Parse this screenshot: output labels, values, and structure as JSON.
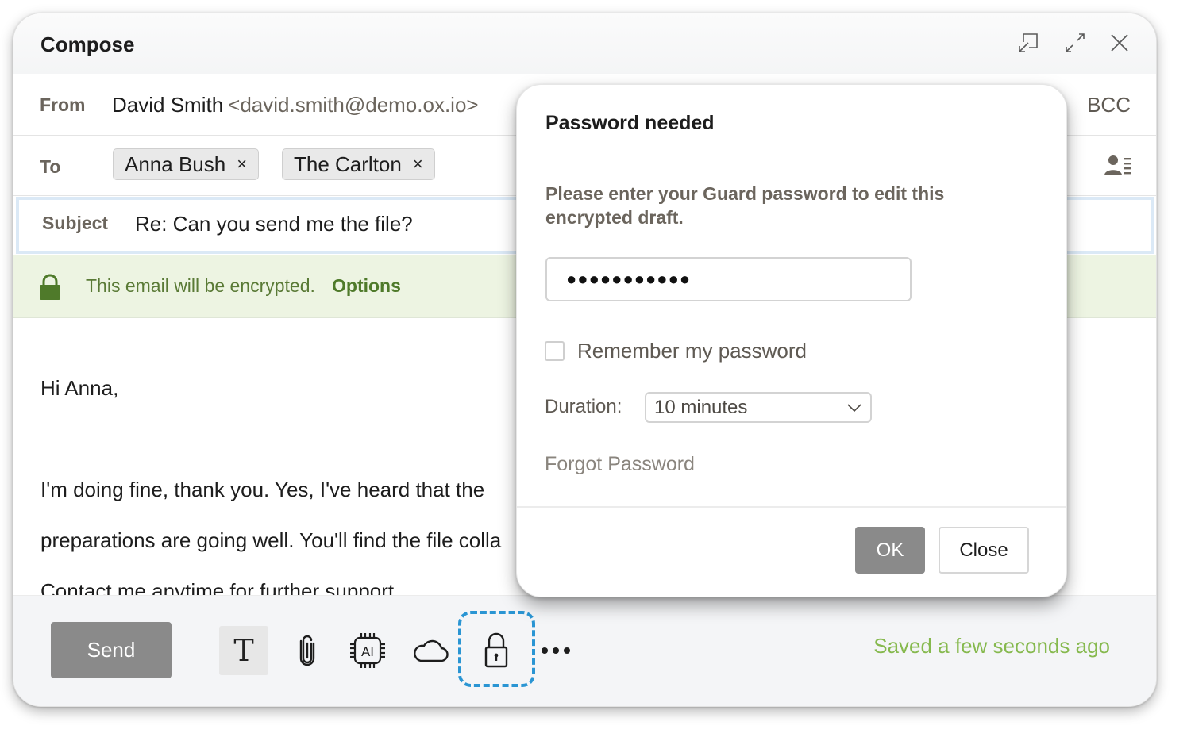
{
  "window": {
    "title": "Compose",
    "controls": [
      {
        "name": "restore-window-icon",
        "label": "Pop out"
      },
      {
        "name": "maximize-icon",
        "label": "Maximize"
      },
      {
        "name": "close-icon",
        "label": "Close"
      }
    ]
  },
  "from": {
    "label": "From",
    "name": "David Smith",
    "email": "<david.smith@demo.ox.io>",
    "bcc_label": "BCC"
  },
  "to": {
    "label": "To",
    "recipients": [
      {
        "name": "Anna Bush",
        "remove": "×"
      },
      {
        "name": "The Carlton",
        "remove": "×"
      }
    ]
  },
  "subject": {
    "label": "Subject",
    "value": "Re: Can you send me the file?"
  },
  "encryption": {
    "message": "This email will be encrypted.",
    "options_label": "Options",
    "color": "#4f7a2a"
  },
  "body": {
    "lines": [
      "Hi Anna,",
      "",
      "I'm doing fine, thank you. Yes, I've heard that the",
      "preparations are going well. You'll find the file colla",
      "Contact me anytime for further support"
    ]
  },
  "footer": {
    "send_label": "Send",
    "tools": [
      {
        "name": "text-format-icon",
        "glyph": "T"
      },
      {
        "name": "paperclip-icon"
      },
      {
        "name": "ai-chip-icon",
        "glyph": "AI"
      },
      {
        "name": "cloud-icon"
      },
      {
        "name": "lock-icon"
      },
      {
        "name": "more-icon"
      }
    ],
    "status": "Saved a few seconds ago",
    "status_color": "#86b94e",
    "highlight_color": "#2a95d3"
  },
  "dialog": {
    "title": "Password needed",
    "description": "Please enter your Guard password to edit this encrypted draft.",
    "password_value": "●●●●●●●●●●●",
    "remember_label": "Remember my password",
    "remember_checked": false,
    "duration_label": "Duration:",
    "duration_value": "10 minutes",
    "forgot_label": "Forgot Password",
    "ok_label": "OK",
    "close_label": "Close"
  }
}
